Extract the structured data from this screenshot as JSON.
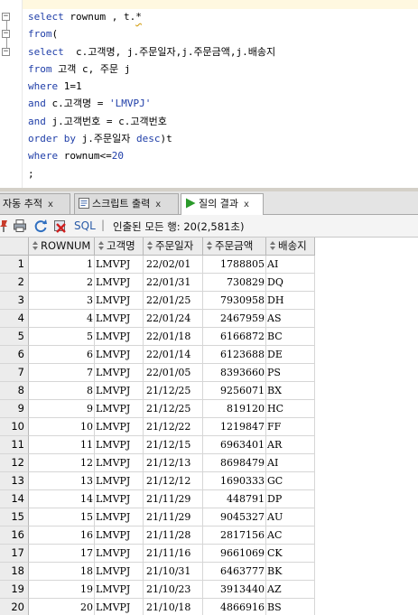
{
  "editor": {
    "lines": [
      [
        {
          "t": "select",
          "c": "kw"
        },
        {
          "t": " rownum , t."
        },
        {
          "t": "*",
          "c": "sq"
        }
      ],
      [
        {
          "t": "from",
          "c": "kw"
        },
        {
          "t": "("
        }
      ],
      [
        {
          "t": "select",
          "c": "kw"
        },
        {
          "t": "  c.고객명, j.주문일자,j.주문금액,j.배송지"
        }
      ],
      [
        {
          "t": "from",
          "c": "kw"
        },
        {
          "t": " 고객 c, 주문 j"
        }
      ],
      [
        {
          "t": "where",
          "c": "kw"
        },
        {
          "t": " 1=1"
        }
      ],
      [
        {
          "t": "and",
          "c": "kw"
        },
        {
          "t": " c.고객명 = "
        },
        {
          "t": "'LMVPJ'",
          "c": "str"
        }
      ],
      [
        {
          "t": "and",
          "c": "kw"
        },
        {
          "t": " j.고객번호 = c.고객번호"
        }
      ],
      [
        {
          "t": "order by",
          "c": "kw"
        },
        {
          "t": " j.주문일자 "
        },
        {
          "t": "desc",
          "c": "kw"
        },
        {
          "t": ")t"
        }
      ],
      [
        {
          "t": "where",
          "c": "kw"
        },
        {
          "t": " rownum<="
        },
        {
          "t": "20",
          "c": "num"
        }
      ],
      [
        {
          "t": ";"
        }
      ]
    ],
    "fold_markers": [
      "⊟",
      "⊟",
      "⊟"
    ]
  },
  "tabs": [
    {
      "label": "자동 추적",
      "close": "x",
      "icon": "trace-icon"
    },
    {
      "label": "스크립트 출력",
      "close": "x",
      "icon": "script-output-icon"
    },
    {
      "label": "질의 결과",
      "close": "x",
      "icon": "run-icon"
    }
  ],
  "toolbar": {
    "sql_label": "SQL",
    "divider": "|",
    "status": "인출된 모든 행: 20(2,581초)"
  },
  "grid": {
    "columns": [
      "ROWNUM",
      "고객명",
      "주문일자",
      "주문금액",
      "배송지"
    ],
    "rows": [
      [
        "1",
        "1",
        "LMVPJ",
        "22/02/01",
        "1788805",
        "AI"
      ],
      [
        "2",
        "2",
        "LMVPJ",
        "22/01/31",
        "730829",
        "DQ"
      ],
      [
        "3",
        "3",
        "LMVPJ",
        "22/01/25",
        "7930958",
        "DH"
      ],
      [
        "4",
        "4",
        "LMVPJ",
        "22/01/24",
        "2467959",
        "AS"
      ],
      [
        "5",
        "5",
        "LMVPJ",
        "22/01/18",
        "6166872",
        "BC"
      ],
      [
        "6",
        "6",
        "LMVPJ",
        "22/01/14",
        "6123688",
        "DE"
      ],
      [
        "7",
        "7",
        "LMVPJ",
        "22/01/05",
        "8393660",
        "PS"
      ],
      [
        "8",
        "8",
        "LMVPJ",
        "21/12/25",
        "9256071",
        "BX"
      ],
      [
        "9",
        "9",
        "LMVPJ",
        "21/12/25",
        "819120",
        "HC"
      ],
      [
        "10",
        "10",
        "LMVPJ",
        "21/12/22",
        "1219847",
        "FF"
      ],
      [
        "11",
        "11",
        "LMVPJ",
        "21/12/15",
        "6963401",
        "AR"
      ],
      [
        "12",
        "12",
        "LMVPJ",
        "21/12/13",
        "8698479",
        "AI"
      ],
      [
        "13",
        "13",
        "LMVPJ",
        "21/12/12",
        "1690333",
        "GC"
      ],
      [
        "14",
        "14",
        "LMVPJ",
        "21/11/29",
        "448791",
        "DP"
      ],
      [
        "15",
        "15",
        "LMVPJ",
        "21/11/29",
        "9045327",
        "AU"
      ],
      [
        "16",
        "16",
        "LMVPJ",
        "21/11/28",
        "2817156",
        "AC"
      ],
      [
        "17",
        "17",
        "LMVPJ",
        "21/11/16",
        "9661069",
        "CK"
      ],
      [
        "18",
        "18",
        "LMVPJ",
        "21/10/31",
        "6463777",
        "BK"
      ],
      [
        "19",
        "19",
        "LMVPJ",
        "21/10/23",
        "3913440",
        "AZ"
      ],
      [
        "20",
        "20",
        "LMVPJ",
        "21/10/18",
        "4866916",
        "BS"
      ]
    ]
  },
  "colors": {
    "keyword": "#1f3ea8",
    "header_bg": "#ececec",
    "tab_bar_bg": "#e4e4e4",
    "run_icon": "#2a9a2a"
  }
}
